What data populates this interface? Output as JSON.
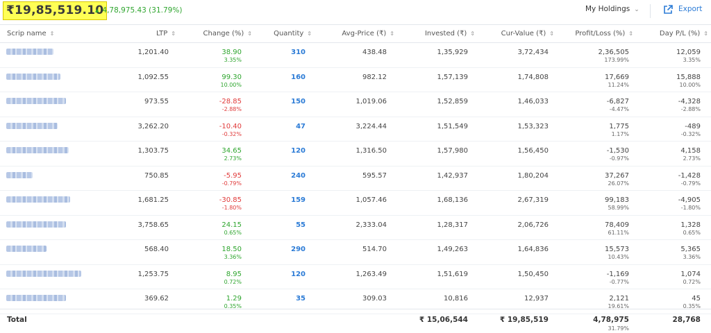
{
  "header": {
    "total_value": "₹19,85,519.10",
    "gain_arrow": "▲",
    "gain_text": "4,78,975.43 (31.79%)",
    "holdings_label": "My Holdings",
    "holdings_chevron": "⌄",
    "export_label": "Export",
    "accent_color": "#2b7bd6",
    "positive_color": "#2ea52e",
    "negative_color": "#e03a3a",
    "highlight_color": "#ffff55"
  },
  "columns": [
    {
      "label": "Scrip name"
    },
    {
      "label": "LTP"
    },
    {
      "label": "Change (%)"
    },
    {
      "label": "Quantity"
    },
    {
      "label": "Avg-Price (₹)"
    },
    {
      "label": "Invested (₹)"
    },
    {
      "label": "Cur-Value (₹)"
    },
    {
      "label": "Profit/Loss (%)"
    },
    {
      "label": "Day P/L (%)"
    }
  ],
  "sort_icon": "⇕",
  "rows": [
    {
      "ltp": "1,201.40",
      "chg": "38.90",
      "chg_pct": "3.35%",
      "dir": "pos",
      "qty": "310",
      "avg": "438.48",
      "inv": "1,35,929",
      "cur": "3,72,434",
      "pl": "2,36,505",
      "pl_pct": "173.99%",
      "day": "12,059",
      "day_pct": "3.35%"
    },
    {
      "ltp": "1,092.55",
      "chg": "99.30",
      "chg_pct": "10.00%",
      "dir": "pos",
      "qty": "160",
      "avg": "982.12",
      "inv": "1,57,139",
      "cur": "1,74,808",
      "pl": "17,669",
      "pl_pct": "11.24%",
      "day": "15,888",
      "day_pct": "10.00%"
    },
    {
      "ltp": "973.55",
      "chg": "-28.85",
      "chg_pct": "-2.88%",
      "dir": "neg",
      "qty": "150",
      "avg": "1,019.06",
      "inv": "1,52,859",
      "cur": "1,46,033",
      "pl": "-6,827",
      "pl_pct": "-4.47%",
      "day": "-4,328",
      "day_pct": "-2.88%"
    },
    {
      "ltp": "3,262.20",
      "chg": "-10.40",
      "chg_pct": "-0.32%",
      "dir": "neg",
      "qty": "47",
      "avg": "3,224.44",
      "inv": "1,51,549",
      "cur": "1,53,323",
      "pl": "1,775",
      "pl_pct": "1.17%",
      "day": "-489",
      "day_pct": "-0.32%"
    },
    {
      "ltp": "1,303.75",
      "chg": "34.65",
      "chg_pct": "2.73%",
      "dir": "pos",
      "qty": "120",
      "avg": "1,316.50",
      "inv": "1,57,980",
      "cur": "1,56,450",
      "pl": "-1,530",
      "pl_pct": "-0.97%",
      "day": "4,158",
      "day_pct": "2.73%"
    },
    {
      "ltp": "750.85",
      "chg": "-5.95",
      "chg_pct": "-0.79%",
      "dir": "neg",
      "qty": "240",
      "avg": "595.57",
      "inv": "1,42,937",
      "cur": "1,80,204",
      "pl": "37,267",
      "pl_pct": "26.07%",
      "day": "-1,428",
      "day_pct": "-0.79%"
    },
    {
      "ltp": "1,681.25",
      "chg": "-30.85",
      "chg_pct": "-1.80%",
      "dir": "neg",
      "qty": "159",
      "avg": "1,057.46",
      "inv": "1,68,136",
      "cur": "2,67,319",
      "pl": "99,183",
      "pl_pct": "58.99%",
      "day": "-4,905",
      "day_pct": "-1.80%"
    },
    {
      "ltp": "3,758.65",
      "chg": "24.15",
      "chg_pct": "0.65%",
      "dir": "pos",
      "qty": "55",
      "avg": "2,333.04",
      "inv": "1,28,317",
      "cur": "2,06,726",
      "pl": "78,409",
      "pl_pct": "61.11%",
      "day": "1,328",
      "day_pct": "0.65%"
    },
    {
      "ltp": "568.40",
      "chg": "18.50",
      "chg_pct": "3.36%",
      "dir": "pos",
      "qty": "290",
      "avg": "514.70",
      "inv": "1,49,263",
      "cur": "1,64,836",
      "pl": "15,573",
      "pl_pct": "10.43%",
      "day": "5,365",
      "day_pct": "3.36%"
    },
    {
      "ltp": "1,253.75",
      "chg": "8.95",
      "chg_pct": "0.72%",
      "dir": "pos",
      "qty": "120",
      "avg": "1,263.49",
      "inv": "1,51,619",
      "cur": "1,50,450",
      "pl": "-1,169",
      "pl_pct": "-0.77%",
      "day": "1,074",
      "day_pct": "0.72%"
    },
    {
      "ltp": "369.62",
      "chg": "1.29",
      "chg_pct": "0.35%",
      "dir": "pos",
      "qty": "35",
      "avg": "309.03",
      "inv": "10,816",
      "cur": "12,937",
      "pl": "2,121",
      "pl_pct": "19.61%",
      "day": "45",
      "day_pct": "0.35%"
    }
  ],
  "footer": {
    "label": "Total",
    "invested": "₹ 15,06,544",
    "cur_value": "₹ 19,85,519",
    "pl": "4,78,975",
    "pl_pct": "31.79%",
    "day_pl": "28,768"
  }
}
